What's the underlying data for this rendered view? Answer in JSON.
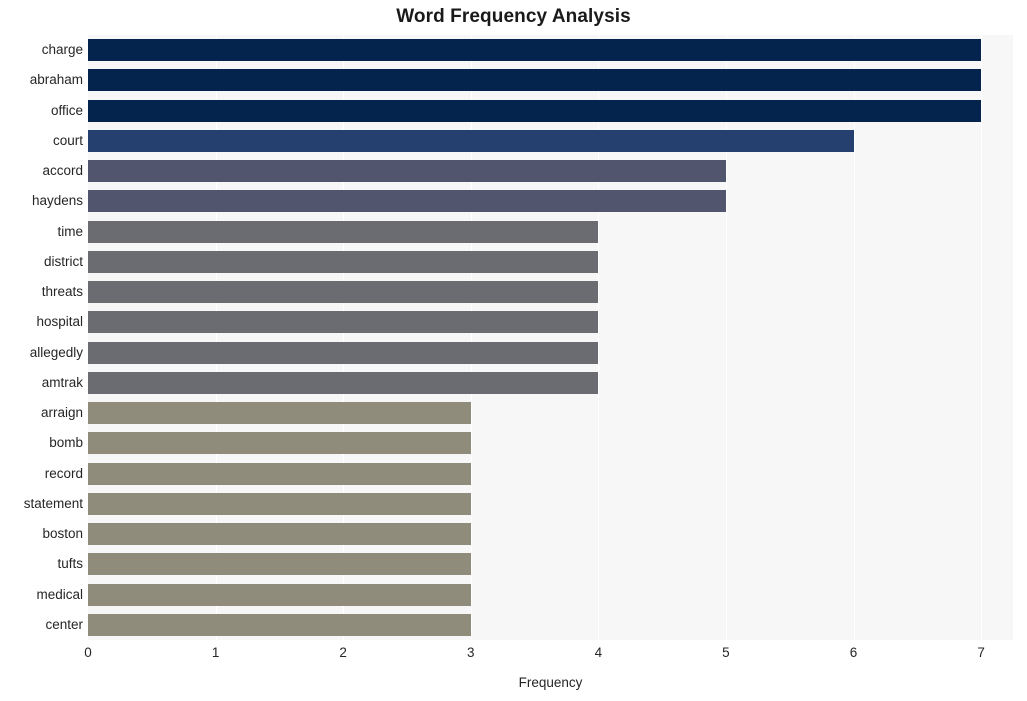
{
  "chart_data": {
    "type": "bar",
    "orientation": "horizontal",
    "title": "Word Frequency Analysis",
    "xlabel": "Frequency",
    "ylabel": "",
    "xlim": [
      0,
      7.25
    ],
    "xticks": [
      0,
      1,
      2,
      3,
      4,
      5,
      6,
      7
    ],
    "xtick_labels": [
      "0",
      "1",
      "2",
      "3",
      "4",
      "5",
      "6",
      "7"
    ],
    "grid": "vertical-white-on-light-gray",
    "legend": "none",
    "categories": [
      "charge",
      "abraham",
      "office",
      "court",
      "accord",
      "haydens",
      "time",
      "district",
      "threats",
      "hospital",
      "allegedly",
      "amtrak",
      "arraign",
      "bomb",
      "record",
      "statement",
      "boston",
      "tufts",
      "medical",
      "center"
    ],
    "values": [
      7,
      7,
      7,
      6,
      5,
      5,
      4,
      4,
      4,
      4,
      4,
      4,
      3,
      3,
      3,
      3,
      3,
      3,
      3,
      3
    ],
    "bar_colors": [
      "#04244d",
      "#04244d",
      "#04244d",
      "#25406f",
      "#51566e",
      "#51566e",
      "#6b6c71",
      "#6b6c71",
      "#6b6c71",
      "#6b6c71",
      "#6b6c71",
      "#6b6c71",
      "#908c7b",
      "#908c7b",
      "#908c7b",
      "#908c7b",
      "#908c7b",
      "#908c7b",
      "#908c7b",
      "#908c7b"
    ]
  },
  "style": {
    "figure_background": "#ffffff",
    "plot_background": "#f7f7f7",
    "gridline_color": "#ffffff",
    "text_color": "#262626",
    "title_color": "#1a1a1a"
  }
}
